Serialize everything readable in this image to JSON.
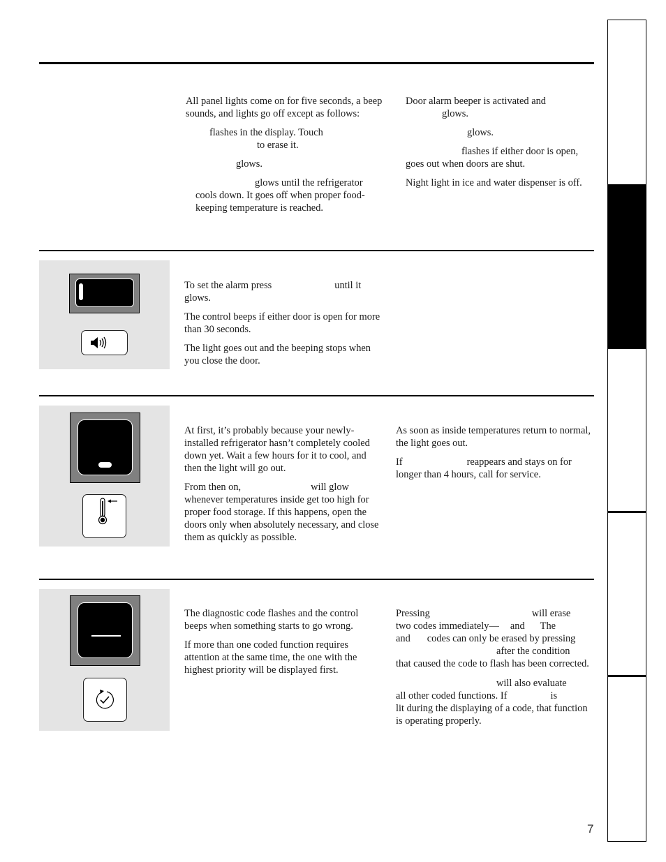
{
  "intro": {
    "left": {
      "p1": "All panel lights come on for five seconds, a beep sounds, and lights go off except as follows:",
      "p2": "flashes in the display. Touch",
      "p2b": "to erase it.",
      "p3": "glows.",
      "p4": "glows until the refrigerator cools down. It goes off when proper food-keeping temperature is reached."
    },
    "right": {
      "p1": "Door alarm beeper is activated and",
      "p1b": "glows.",
      "p2": "glows.",
      "p3": "flashes if either door is open, goes out when doors are shut.",
      "p4": "Night light in ice and water dispenser is off."
    }
  },
  "door_alarm": {
    "icon": "speaker-icon",
    "p1a": "To set the alarm press",
    "p1b": "until it glows.",
    "p2": "The control beeps if either door is open for more than 30 seconds.",
    "p3": "The light goes out and the beeping stops when you close the door."
  },
  "temperature": {
    "icon": "thermometer-icon",
    "left": {
      "p1": "At first, it’s probably because your newly-installed refrigerator hasn’t completely cooled down yet. Wait a few hours for it to cool, and then the light will go out.",
      "p2a": "From then on,",
      "p2b": "will glow whenever temperatures inside get too high for proper food storage. If this happens, open the doors only when absolutely necessary, and close them as quickly as possible."
    },
    "right": {
      "p1": "As soon as inside temperatures return to normal, the light goes out.",
      "p2a": "If",
      "p2b": "reappears and stays on for longer than 4 hours, call for service."
    }
  },
  "diagnostic": {
    "icon": "check-cycle-icon",
    "left": {
      "p1": "The diagnostic code flashes and the control beeps when something starts to go wrong.",
      "p2": "If more than one coded function requires attention at the same time, the one with the highest priority will be displayed first."
    },
    "right": {
      "l1a": "Pressing",
      "l1b": "will erase",
      "l2a": "two codes immediately—",
      "l2b": "and",
      "l2c": "The",
      "l3a": "and",
      "l3b": "codes can only be erased by pressing",
      "l4": "after the condition",
      "l5": "that caused the code to flash has been corrected.",
      "l6": "will also evaluate",
      "l7a": "all other coded functions. If",
      "l7b": "is",
      "l8": "lit during the displaying of a code, that function is operating properly."
    }
  },
  "page_number": "7"
}
